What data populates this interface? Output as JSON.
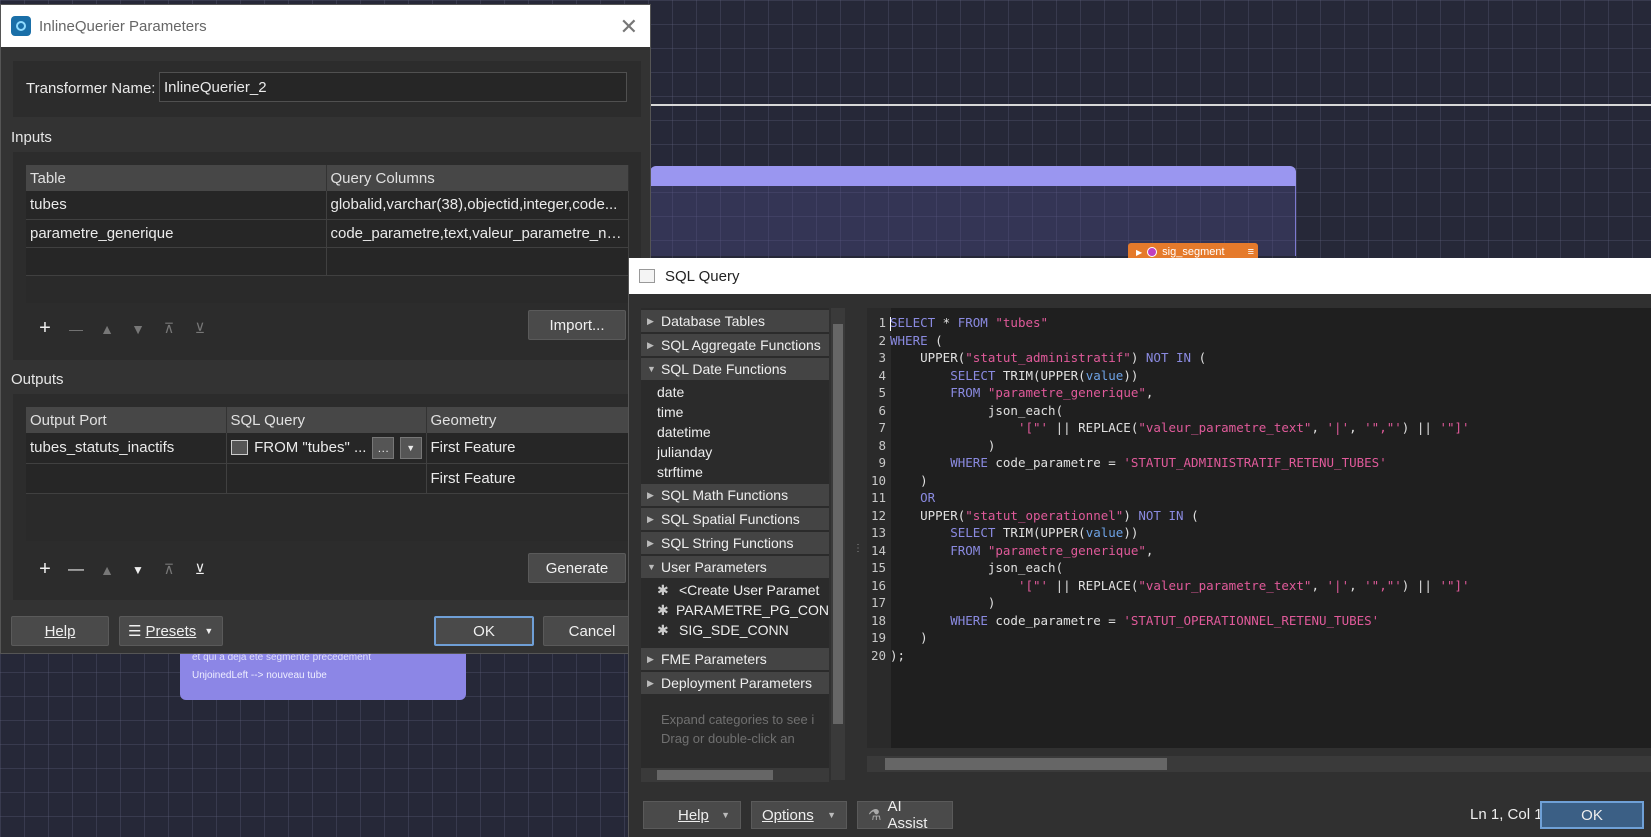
{
  "canvas": {
    "node_label": "sig_segment",
    "note_lines": [
      "et qui a déjà été segmenté précédement",
      "UnjoinedLeft --> nouveau tube"
    ]
  },
  "inline_querier": {
    "title": "InlineQuerier Parameters",
    "transformer_name_label": "Transformer Name:",
    "transformer_name_value": "InlineQuerier_2",
    "inputs_title": "Inputs",
    "inputs_columns": [
      "Table",
      "Query Columns"
    ],
    "inputs_rows": [
      [
        "tubes",
        "globalid,varchar(38),objectid,integer,code..."
      ],
      [
        "parametre_generique",
        "code_parametre,text,valeur_parametre_nu..."
      ],
      [
        "",
        ""
      ]
    ],
    "import_label": "Import...",
    "outputs_title": "Outputs",
    "outputs_columns": [
      "Output Port",
      "SQL Query",
      "Geometry"
    ],
    "outputs_rows": [
      {
        "port": "tubes_statuts_inactifs",
        "query": "FROM \"tubes\" ...",
        "geometry": "First Feature"
      },
      {
        "port": "",
        "query": "",
        "geometry": "First Feature"
      }
    ],
    "generate_label": "Generate",
    "help_label": "Help",
    "presets_label": "Presets",
    "ok_label": "OK",
    "cancel_label": "Cancel"
  },
  "sql_query": {
    "title": "SQL Query",
    "categories": [
      {
        "label": "Database Tables",
        "expanded": false,
        "items": []
      },
      {
        "label": "SQL Aggregate Functions",
        "expanded": false,
        "items": []
      },
      {
        "label": "SQL Date Functions",
        "expanded": true,
        "items": [
          "date",
          "time",
          "datetime",
          "julianday",
          "strftime"
        ]
      },
      {
        "label": "SQL Math Functions",
        "expanded": false,
        "items": []
      },
      {
        "label": "SQL Spatial Functions",
        "expanded": false,
        "items": []
      },
      {
        "label": "SQL String Functions",
        "expanded": false,
        "items": []
      },
      {
        "label": "User Parameters",
        "expanded": true,
        "items": [
          "<Create User Paramet",
          "PARAMETRE_PG_CON",
          "SIG_SDE_CONN"
        ]
      },
      {
        "label": "FME Parameters",
        "expanded": false,
        "items": []
      },
      {
        "label": "Deployment Parameters",
        "expanded": false,
        "items": []
      }
    ],
    "tree_hint_lines": [
      "Expand categories to see i",
      "Drag or double-click an"
    ],
    "code_lines": [
      "SELECT * FROM \"tubes\"",
      "WHERE (",
      "    UPPER(\"statut_administratif\") NOT IN (",
      "        SELECT TRIM(UPPER(value))",
      "        FROM \"parametre_generique\",",
      "             json_each(",
      "                 '[\"' || REPLACE(\"valeur_parametre_text\", '|', '\",\"') || '\"]'",
      "             )",
      "        WHERE code_parametre = 'STATUT_ADMINISTRATIF_RETENU_TUBES'",
      "    )",
      "    OR",
      "    UPPER(\"statut_operationnel\") NOT IN (",
      "        SELECT TRIM(UPPER(value))",
      "        FROM \"parametre_generique\",",
      "             json_each(",
      "                 '[\"' || REPLACE(\"valeur_parametre_text\", '|', '\",\"') || '\"]'",
      "             )",
      "        WHERE code_parametre = 'STATUT_OPERATIONNEL_RETENU_TUBES'",
      "    )",
      ");"
    ],
    "help_label": "Help",
    "options_label": "Options",
    "ai_assist_label": "AI Assist",
    "cursor_position": "Ln 1, Col 1",
    "ok_label": "OK"
  }
}
